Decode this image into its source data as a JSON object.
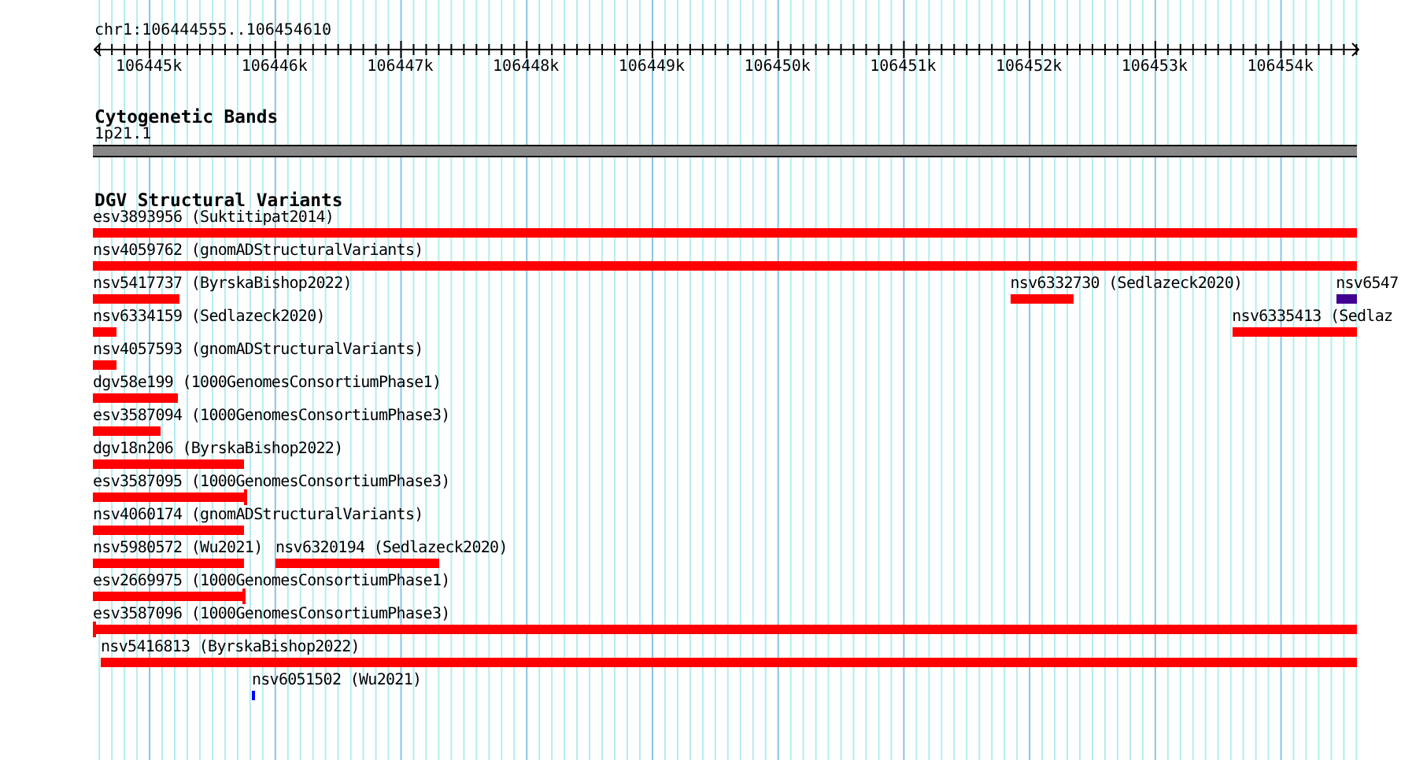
{
  "ruler": {
    "location": "chr1:106444555..106454610",
    "ticks": [
      "106445k",
      "106446k",
      "106447k",
      "106448k",
      "106449k",
      "106450k",
      "106451k",
      "106452k",
      "106453k",
      "106454k"
    ]
  },
  "cytobands": {
    "title": "Cytogenetic Bands",
    "band": "1p21.1"
  },
  "variants": {
    "title": "DGV Structural Variants",
    "rows": [
      {
        "features": [
          {
            "label": "esv3893956 (Suktitipat2014)",
            "color": "#ff0000",
            "start_cap": false,
            "end_cap": false
          }
        ]
      },
      {
        "features": [
          {
            "label": "nsv4059762 (gnomADStructuralVariants)",
            "color": "#ff0000",
            "start_cap": false,
            "end_cap": false
          }
        ]
      },
      {
        "features": [
          {
            "label": "nsv5417737 (ByrskaBishop2022)",
            "color": "#ff0000",
            "start_cap": false,
            "end_cap": false
          },
          {
            "label": "nsv6332730 (Sedlazeck2020)",
            "color": "#ff0000",
            "start_cap": false,
            "end_cap": false
          },
          {
            "label": "nsv6547",
            "color": "#400090",
            "start_cap": false,
            "end_cap": false
          }
        ]
      },
      {
        "features": [
          {
            "label": "nsv6334159 (Sedlazeck2020)",
            "color": "#ff0000",
            "start_cap": false,
            "end_cap": false
          },
          {
            "label": "nsv6335413 (Sedlaz",
            "color": "#ff0000",
            "start_cap": false,
            "end_cap": false
          }
        ]
      },
      {
        "features": [
          {
            "label": "nsv4057593 (gnomADStructuralVariants)",
            "color": "#ff0000",
            "start_cap": false,
            "end_cap": false
          }
        ]
      },
      {
        "features": [
          {
            "label": "dgv58e199 (1000GenomesConsortiumPhase1)",
            "color": "#ff0000",
            "start_cap": false,
            "end_cap": false
          }
        ]
      },
      {
        "features": [
          {
            "label": "esv3587094 (1000GenomesConsortiumPhase3)",
            "color": "#ff0000",
            "start_cap": false,
            "end_cap": false
          }
        ]
      },
      {
        "features": [
          {
            "label": "dgv18n206 (ByrskaBishop2022)",
            "color": "#ff0000",
            "start_cap": false,
            "end_cap": false
          }
        ]
      },
      {
        "features": [
          {
            "label": "esv3587095 (1000GenomesConsortiumPhase3)",
            "color": "#ff0000",
            "start_cap": false,
            "end_cap": true
          }
        ]
      },
      {
        "features": [
          {
            "label": "nsv4060174 (gnomADStructuralVariants)",
            "color": "#ff0000",
            "start_cap": false,
            "end_cap": false
          }
        ]
      },
      {
        "features": [
          {
            "label": "nsv5980572 (Wu2021)",
            "color": "#ff0000",
            "start_cap": false,
            "end_cap": false
          },
          {
            "label": "nsv6320194 (Sedlazeck2020)",
            "color": "#ff0000",
            "start_cap": false,
            "end_cap": false
          }
        ]
      },
      {
        "features": [
          {
            "label": "esv2669975 (1000GenomesConsortiumPhase1)",
            "color": "#ff0000",
            "start_cap": false,
            "end_cap": true
          }
        ]
      },
      {
        "features": [
          {
            "label": "esv3587096 (1000GenomesConsortiumPhase3)",
            "color": "#ff0000",
            "start_cap": true,
            "end_cap": false
          }
        ]
      },
      {
        "features": [
          {
            "label": "nsv5416813 (ByrskaBishop2022)",
            "color": "#ff0000",
            "start_cap": false,
            "end_cap": false
          }
        ]
      },
      {
        "features": [
          {
            "label": "nsv6051502 (Wu2021)",
            "color": "#0000ff",
            "start_cap": false,
            "end_cap": false
          }
        ]
      }
    ]
  }
}
